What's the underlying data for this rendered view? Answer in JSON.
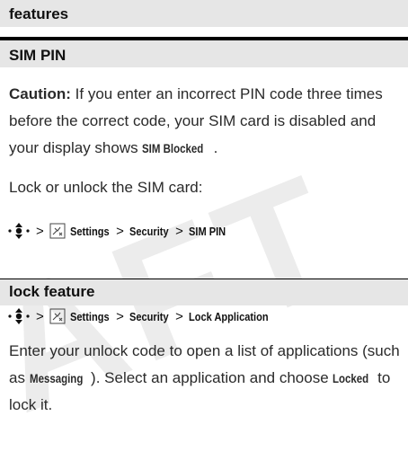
{
  "header": {
    "section_label": "features"
  },
  "sim_pin": {
    "title": "SIM PIN",
    "caution_label": "Caution:",
    "caution_text_1": " If you enter an incorrect PIN code three times before the correct code, your SIM card is disabled and your display shows ",
    "caution_highlight": "SIM Blocked",
    "caution_text_2": ".",
    "lock_instruction": "Lock or unlock the SIM card:",
    "path": {
      "settings": "Settings",
      "security": "Security",
      "target": "SIM PIN"
    },
    "separator": ">"
  },
  "lock_feature": {
    "title": "lock feature",
    "path": {
      "settings": "Settings",
      "security": "Security",
      "target": "Lock Application"
    },
    "separator": ">",
    "text_1": "Enter your unlock code to open a list of applications (such as ",
    "highlight_1": "Messaging",
    "text_2": "). Select an application and choose ",
    "highlight_2": "Locked",
    "text_3": " to lock it."
  },
  "watermark": {
    "text": "AFT"
  },
  "icons": {
    "nav_key": "nav-key-icon",
    "settings": "settings-icon"
  }
}
